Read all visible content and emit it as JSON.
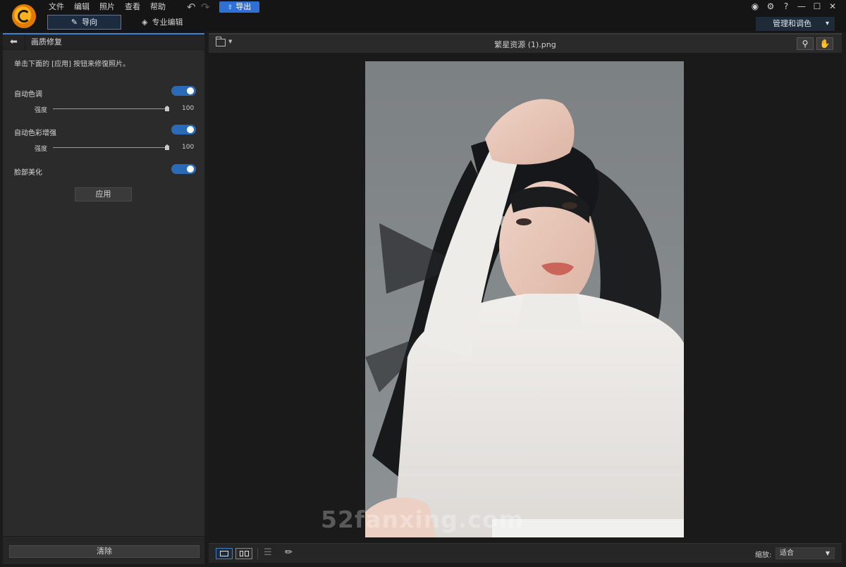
{
  "menu": [
    "文件",
    "编辑",
    "照片",
    "查看",
    "帮助"
  ],
  "toolbar": {
    "export_label": "导出"
  },
  "modes": {
    "guide": "导向",
    "pro": "专业编辑"
  },
  "window": {
    "manage_label": "管理和调色",
    "help": "?"
  },
  "panel": {
    "title": "画质修复",
    "hint": "单击下面的 [应用] 按钮来修復照片。",
    "options": [
      {
        "label": "自动色调",
        "enabled": true,
        "strength_label": "强度",
        "strength": 100
      },
      {
        "label": "自动色彩增强",
        "enabled": true,
        "strength_label": "强度",
        "strength": 100
      },
      {
        "label": "脸部美化",
        "enabled": true
      }
    ],
    "apply_label": "应用",
    "clear_label": "清除"
  },
  "viewer": {
    "file_name": "繁星资源 (1).png",
    "zoom_label": "缩放:",
    "zoom_value": "适合",
    "watermark": "52fanxing.com"
  },
  "colors": {
    "accent": "#3c82d1",
    "toggle_on": "#2a6bb8",
    "export": "#2f6fd6"
  }
}
